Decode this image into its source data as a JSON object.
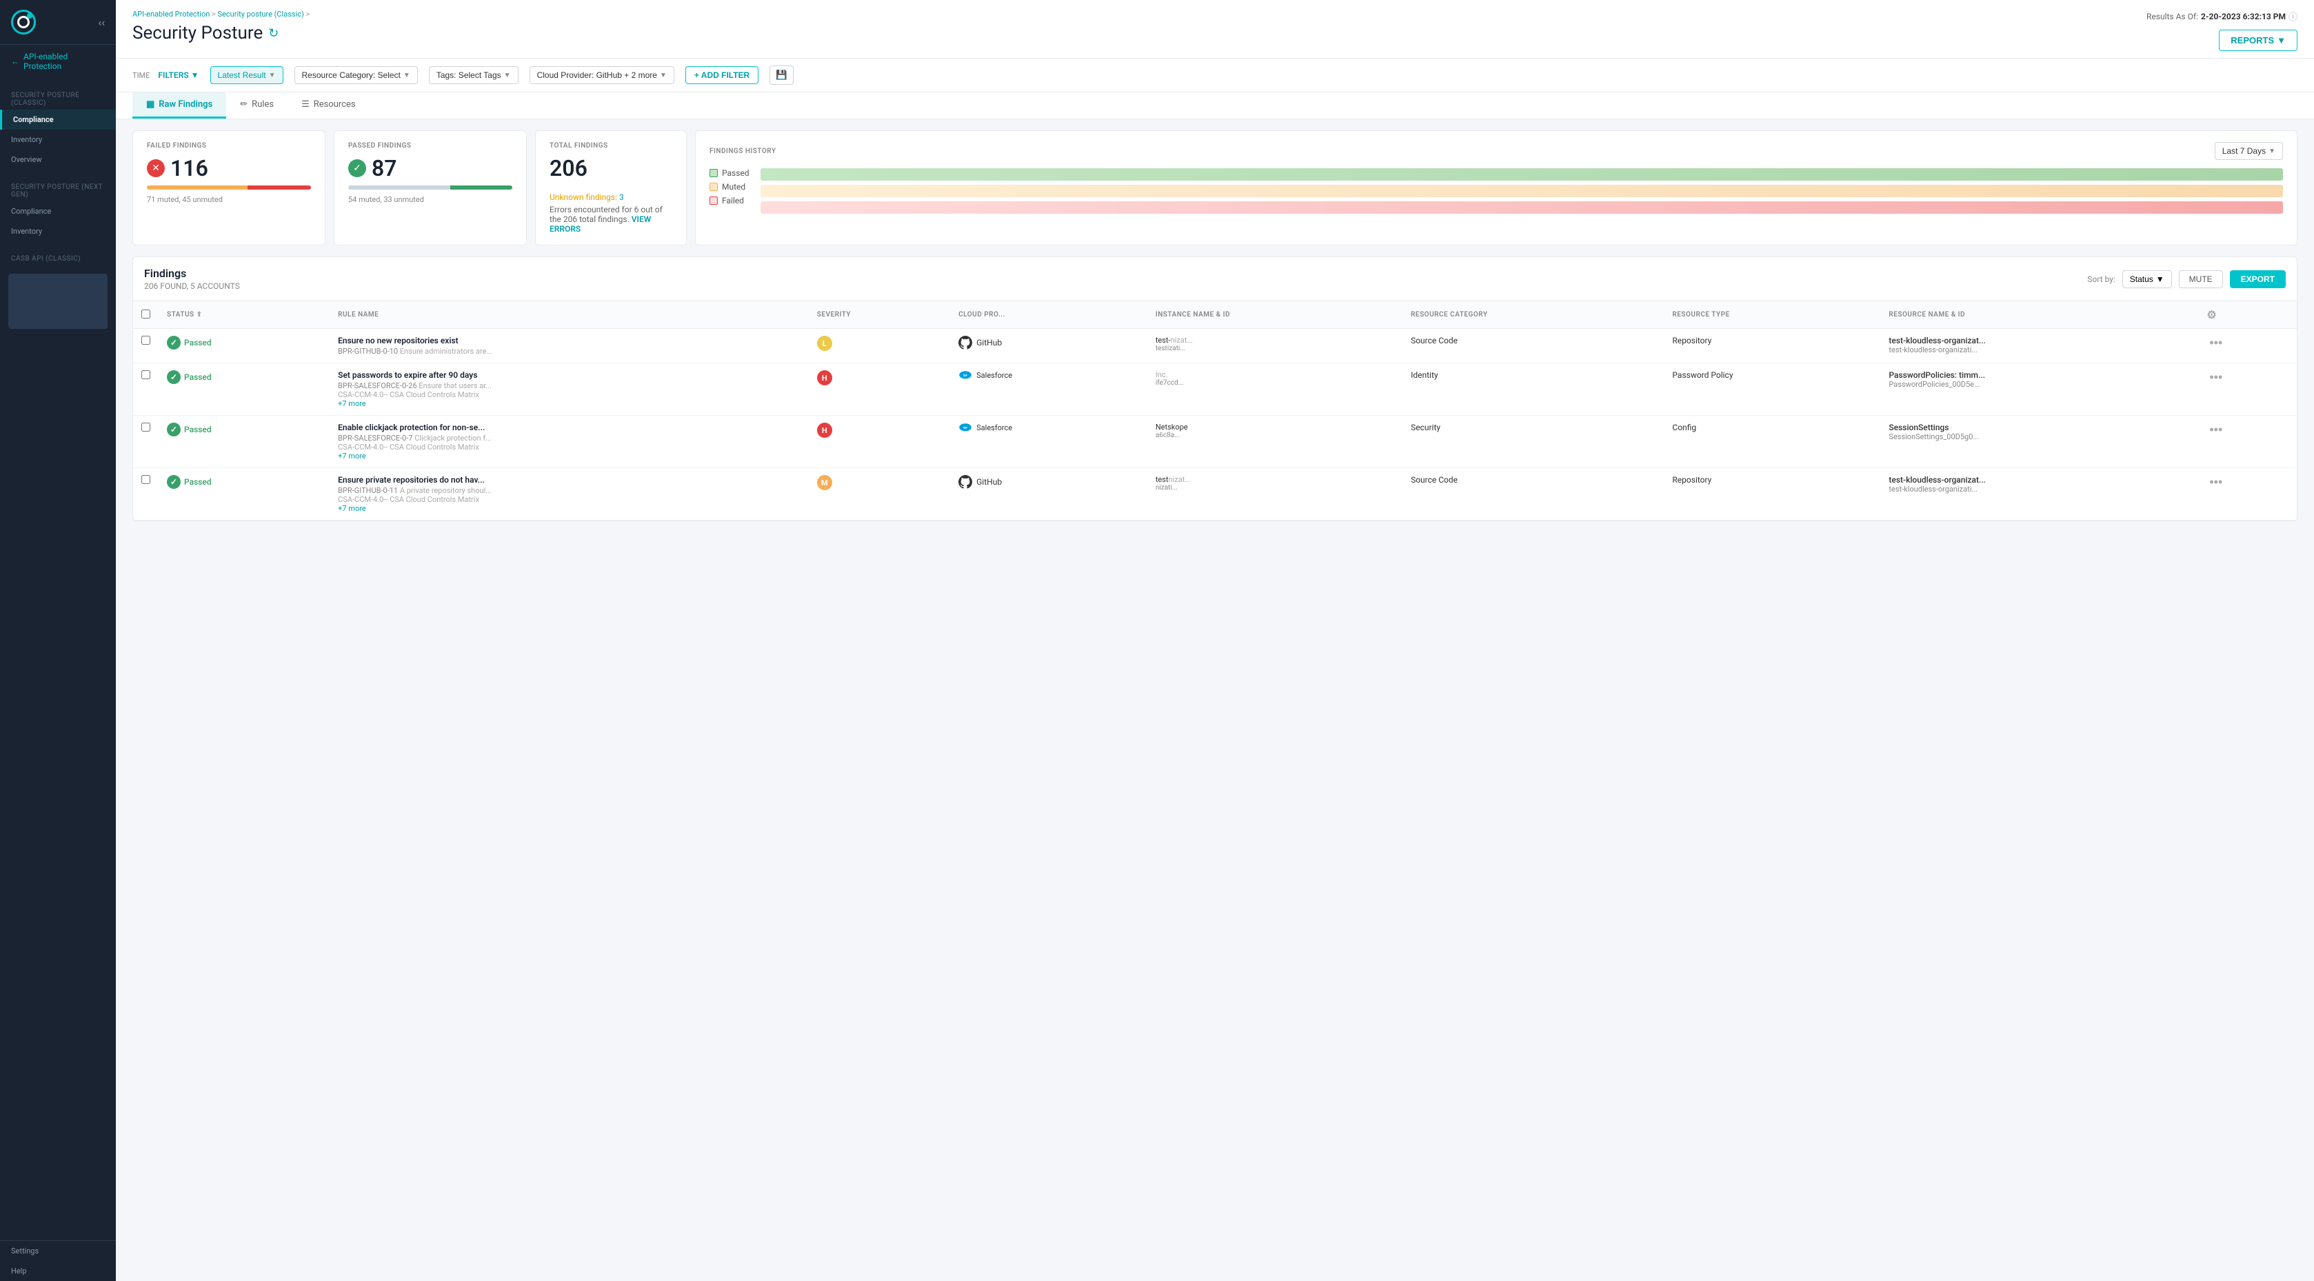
{
  "sidebar": {
    "logo_alt": "Netskope logo",
    "back_label": "API-enabled Protection",
    "section1_header": "SECURITY POSTURE (CLASSIC)",
    "nav1": [
      {
        "id": "compliance",
        "label": "Compliance",
        "active": true,
        "highlighted": true
      },
      {
        "id": "inventory",
        "label": "Inventory"
      },
      {
        "id": "overview",
        "label": "Overview"
      }
    ],
    "section2_header": "SECURITY POSTURE (NEXT GEN)",
    "nav2": [
      {
        "id": "compliance2",
        "label": "Compliance"
      },
      {
        "id": "inventory2",
        "label": "Inventory"
      }
    ],
    "section3_header": "CASB API (CLASSIC)",
    "bottom_items": [
      {
        "id": "settings",
        "label": "Settings"
      },
      {
        "id": "help",
        "label": "Help"
      }
    ]
  },
  "header": {
    "breadcrumb": [
      "API-enabled Protection",
      "Security posture (Classic)"
    ],
    "page_title": "Security Posture",
    "results_label": "Results As Of:",
    "results_date": "2-20-2023 6:32:13 PM",
    "info_tooltip": "Information",
    "reports_label": "REPORTS"
  },
  "toolbar": {
    "time_label": "TIME",
    "filters_label": "FILTERS",
    "latest_result_label": "Latest Result",
    "resource_category_label": "Resource Category: Select",
    "tags_label": "Tags: Select Tags",
    "cloud_provider_label": "Cloud Provider: GitHub + 2 more",
    "add_filter_label": "+ ADD FILTER",
    "save_label": "💾"
  },
  "tabs": [
    {
      "id": "raw-findings",
      "label": "Raw Findings",
      "active": true,
      "icon": "grid"
    },
    {
      "id": "rules",
      "label": "Rules",
      "icon": "edit"
    },
    {
      "id": "resources",
      "label": "Resources",
      "icon": "list"
    }
  ],
  "stats": {
    "failed": {
      "label": "FAILED FINDINGS",
      "value": "116",
      "bar_orange": 71,
      "bar_red": 45,
      "sub": "71 muted, 45 unmuted"
    },
    "passed": {
      "label": "PASSED FINDINGS",
      "value": "87",
      "bar_gray": 54,
      "bar_green": 33,
      "sub": "54 muted, 33 unmuted"
    },
    "total": {
      "label": "TOTAL FINDINGS",
      "value": "206"
    },
    "unknown": {
      "text": "Unknown findings:",
      "count": "3"
    },
    "error_text": "Errors encountered for 6 out of the 206 total findings.",
    "view_errors": "VIEW ERRORS"
  },
  "findings_history": {
    "label": "FINDINGS HISTORY",
    "time_range": "Last 7 Days",
    "legend": [
      {
        "id": "passed",
        "label": "Passed",
        "color": "#c3e6c3"
      },
      {
        "id": "muted",
        "label": "Muted",
        "color": "#fde8c3"
      },
      {
        "id": "failed",
        "label": "Failed",
        "color": "#fdd"
      }
    ]
  },
  "findings_table": {
    "title": "Findings",
    "count_label": "206 FOUND, 5 ACCOUNTS",
    "sort_label": "Sort by:",
    "sort_value": "Status",
    "mute_label": "MUTE",
    "export_label": "EXPORT",
    "columns": [
      "STATUS",
      "RULE NAME",
      "SEVERITY",
      "CLOUD PRO...",
      "INSTANCE NAME & ID",
      "RESOURCE CATEGORY",
      "RESOURCE TYPE",
      "RESOURCE NAME & ID"
    ],
    "rows": [
      {
        "status": "Passed",
        "status_type": "passed",
        "rule_name": "Ensure no new repositories exist",
        "rule_code": "BPR-GITHUB-0-10",
        "rule_desc": "Ensure administrators are...",
        "severity": "L",
        "cloud": "GitHub",
        "cloud_type": "github",
        "instance_name": "test-",
        "instance_name2": "nizat...",
        "instance_id": "test",
        "instance_id2": "izati...",
        "resource_category": "Source Code",
        "resource_type": "Repository",
        "resource_name": "test-kloudless-organizat...",
        "resource_id": "test-kloudless-organizati..."
      },
      {
        "status": "Passed",
        "status_type": "passed",
        "rule_name": "Set passwords to expire after 90 days",
        "rule_code": "BPR-SALESFORCE-0-26",
        "rule_desc": "Ensure that users ar...",
        "rule_extra1": "CSA-CCM-4.0-- CSA Cloud Controls Matrix",
        "rule_extra2": "+7 more",
        "severity": "H",
        "cloud": "Salesforce",
        "cloud_type": "salesforce",
        "instance_name": "",
        "instance_name2": "Inc.",
        "instance_id": "",
        "instance_id2": "ife7ccd...",
        "resource_category": "Identity",
        "resource_type": "Password Policy",
        "resource_name": "PasswordPolicies: timm...",
        "resource_id": "PasswordPolicies_00D5e..."
      },
      {
        "status": "Passed",
        "status_type": "passed",
        "rule_name": "Enable clickjack protection for non-se...",
        "rule_code": "BPR-SALESFORCE-0-7",
        "rule_desc": "Clickjack protection f...",
        "rule_extra1": "CSA-CCM-4.0-- CSA Cloud Controls Matrix",
        "rule_extra2": "+7 more",
        "severity": "H",
        "cloud": "Salesforce",
        "cloud_type": "salesforce",
        "instance_name": "Netskope",
        "instance_name2": "",
        "instance_id": "",
        "instance_id2": "a6c8a...",
        "resource_category": "Security",
        "resource_type": "Config",
        "resource_name": "SessionSettings",
        "resource_id": "SessionSettings_00D5g0..."
      },
      {
        "status": "Passed",
        "status_type": "passed",
        "rule_name": "Ensure private repositories do not hav...",
        "rule_code": "BPR-GITHUB-0-11",
        "rule_desc": "A private repository shoul...",
        "rule_extra1": "CSA-CCM-4.0-- CSA Cloud Controls Matrix",
        "rule_extra2": "+7 more",
        "severity": "M",
        "cloud": "GitHub",
        "cloud_type": "github",
        "instance_name": "test",
        "instance_name2": "nizat...",
        "instance_id": "",
        "instance_id2": "nizati...",
        "resource_category": "Source Code",
        "resource_type": "Repository",
        "resource_name": "test-kloudless-organizat...",
        "resource_id": "test-kloudless-organizati..."
      }
    ]
  }
}
